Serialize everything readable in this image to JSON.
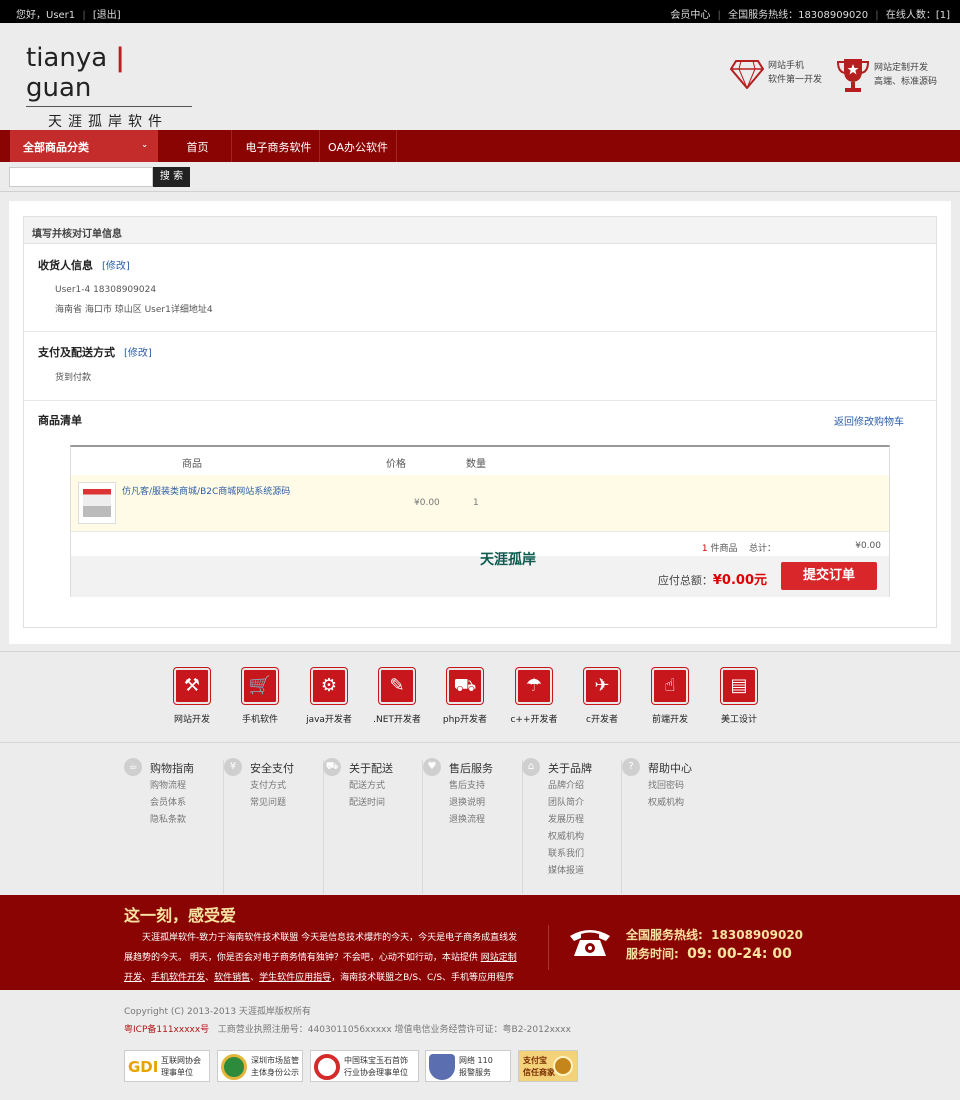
{
  "topbar": {
    "greeting": "您好，User1",
    "logout": "[退出]",
    "member": "会员中心",
    "hotline": "全国服务热线：18308909020",
    "online": "在线人数：[1]"
  },
  "logo": {
    "en_a": "tianya",
    "en_sep": "|",
    "en_b": "guan",
    "cn": "天涯孤岸软件"
  },
  "promo": [
    {
      "line1": "网站手机",
      "line2": "软件第一开发"
    },
    {
      "line1": "网站定制开发",
      "line2": "高端、标准源码"
    }
  ],
  "nav": {
    "category": "全部商品分类",
    "items": [
      "首页",
      "电子商务软件",
      "OA办公软件"
    ]
  },
  "search": {
    "placeholder": "",
    "button": "搜 索"
  },
  "order": {
    "title": "填写并核对订单信息",
    "receiver": {
      "heading": "收货人信息",
      "modify": "[修改]",
      "line1": "User1-4   18308909024",
      "line2": "海南省 海口市 琼山区   User1详细地址4"
    },
    "payment": {
      "heading": "支付及配送方式",
      "modify": "[修改]",
      "method": "货到付款"
    },
    "goods": {
      "heading": "商品清单",
      "back": "返回修改购物车",
      "cols": {
        "product": "商品",
        "price": "价格",
        "qty": "数量"
      },
      "items": [
        {
          "name": "仿凡客/服装类商城/B2C商城网站系统源码",
          "price": "¥0.00",
          "qty": "1"
        }
      ],
      "count": "1",
      "count_label": "件商品",
      "total_label": "总计：",
      "total": "¥0.00",
      "pay_label": "应付总额：",
      "pay_total": "¥0.00元",
      "submit": "提交订单"
    }
  },
  "watermark": "天涯孤岸",
  "services": [
    {
      "label": "网站开发",
      "icon": "tools-icon"
    },
    {
      "label": "手机软件",
      "icon": "cart-icon"
    },
    {
      "label": "java开发者",
      "icon": "gears-icon"
    },
    {
      "label": ".NET开发者",
      "icon": "edit-icon"
    },
    {
      "label": "php开发者",
      "icon": "truck-icon"
    },
    {
      "label": "c++开发者",
      "icon": "umbrella-icon"
    },
    {
      "label": "c开发者",
      "icon": "plane-icon"
    },
    {
      "label": "前端开发",
      "icon": "thumb-icon"
    },
    {
      "label": "美工设计",
      "icon": "gift-icon"
    }
  ],
  "help": [
    {
      "title": "购物指南",
      "icon": "cup-icon",
      "links": [
        "购物流程",
        "会员体系",
        "隐私条款"
      ]
    },
    {
      "title": "安全支付",
      "icon": "yen-icon",
      "links": [
        "支付方式",
        "常见问题"
      ]
    },
    {
      "title": "关于配送",
      "icon": "truck-icon",
      "links": [
        "配送方式",
        "配送时间"
      ]
    },
    {
      "title": "售后服务",
      "icon": "heart-icon",
      "links": [
        "售后支持",
        "退换说明",
        "退换流程"
      ]
    },
    {
      "title": "关于品牌",
      "icon": "home-icon",
      "links": [
        "品牌介绍",
        "团队简介",
        "发展历程",
        "权威机构",
        "联系我们",
        "媒体报道"
      ]
    },
    {
      "title": "帮助中心",
      "icon": "question-icon",
      "links": [
        "找回密码",
        "权威机构"
      ]
    }
  ],
  "footer": {
    "slogan": "这一刻，感受爱",
    "desc1": "天涯孤岸软件-致力于海南软件技术联盟 今天是信息技术爆炸的今天，今天是电子商务成直线发展趋势的今天。 明天，你是否会对电子商务情有独钟？不会吧，心动不如行动，本站提供",
    "desc_link1": "网站定制开发",
    "desc_mid1": "、",
    "desc_link2": "手机软件开发",
    "desc_mid2": "、",
    "desc_link3": "软件销售",
    "desc_mid3": "、",
    "desc_link4": "学生软件应用指导",
    "desc2": "，海南技术联盟之B/S、C/S、手机等应用程序第一开发。",
    "hotline_label": "全国服务热线:",
    "hotline": "18308909020",
    "hours_label": "服务时间:",
    "hours": "09: 00-24: 00",
    "copyright": "Copyright (C) 2013-2013 天涯孤岸版权所有",
    "icp": "粤ICP备111xxxxx号",
    "license": "工商营业执照注册号：4403011056xxxxx   增值电信业务经营许可证：粤B2-2012xxxx",
    "badges": [
      {
        "l1": "互联网协会",
        "l2": "理事单位",
        "mark": "GDI"
      },
      {
        "l1": "深圳市场监管",
        "l2": "主体身份公示",
        "mark": ""
      },
      {
        "l1": "中国珠宝玉石首饰",
        "l2": "行业协会理事单位",
        "mark": ""
      },
      {
        "l1": "网络 110",
        "l2": "报警服务",
        "mark": ""
      },
      {
        "l1": "支付宝",
        "l2": "信任商家",
        "mark": ""
      }
    ]
  }
}
